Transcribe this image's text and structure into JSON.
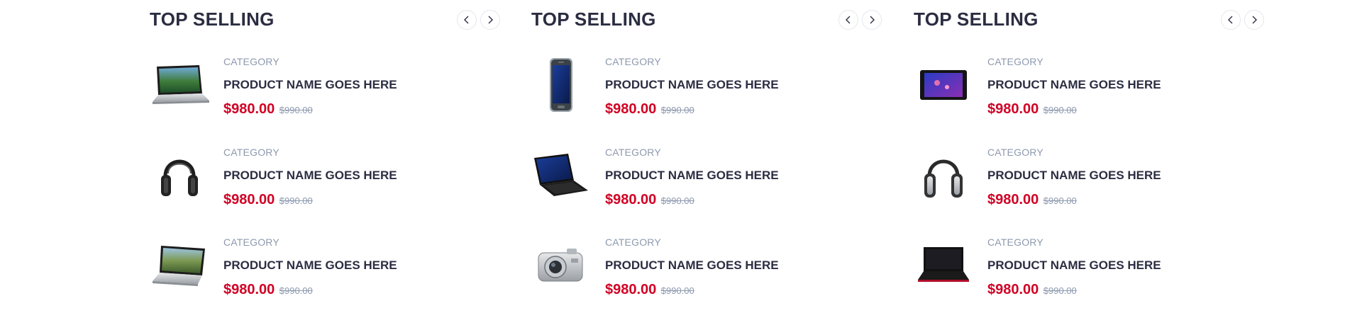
{
  "columns": [
    {
      "title": "TOP SELLING",
      "products": [
        {
          "icon": "laptop-silver-icon",
          "category": "CATEGORY",
          "name": "PRODUCT NAME GOES HERE",
          "price": "$980.00",
          "old_price": "$990.00"
        },
        {
          "icon": "headphones-black-icon",
          "category": "CATEGORY",
          "name": "PRODUCT NAME GOES HERE",
          "price": "$980.00",
          "old_price": "$990.00"
        },
        {
          "icon": "laptop-landscape-icon",
          "category": "CATEGORY",
          "name": "PRODUCT NAME GOES HERE",
          "price": "$980.00",
          "old_price": "$990.00"
        }
      ]
    },
    {
      "title": "TOP SELLING",
      "products": [
        {
          "icon": "smartphone-icon",
          "category": "CATEGORY",
          "name": "PRODUCT NAME GOES HERE",
          "price": "$980.00",
          "old_price": "$990.00"
        },
        {
          "icon": "laptop-dark-icon",
          "category": "CATEGORY",
          "name": "PRODUCT NAME GOES HERE",
          "price": "$980.00",
          "old_price": "$990.00"
        },
        {
          "icon": "camera-icon",
          "category": "CATEGORY",
          "name": "PRODUCT NAME GOES HERE",
          "price": "$980.00",
          "old_price": "$990.00"
        }
      ]
    },
    {
      "title": "TOP SELLING",
      "products": [
        {
          "icon": "tablet-icon",
          "category": "CATEGORY",
          "name": "PRODUCT NAME GOES HERE",
          "price": "$980.00",
          "old_price": "$990.00"
        },
        {
          "icon": "headphones-silver-icon",
          "category": "CATEGORY",
          "name": "PRODUCT NAME GOES HERE",
          "price": "$980.00",
          "old_price": "$990.00"
        },
        {
          "icon": "laptop-red-icon",
          "category": "CATEGORY",
          "name": "PRODUCT NAME GOES HERE",
          "price": "$980.00",
          "old_price": "$990.00"
        }
      ]
    }
  ],
  "nav": {
    "prev_icon": "chevron-left-icon",
    "next_icon": "chevron-right-icon"
  },
  "colors": {
    "accent": "#D10024",
    "text": "#2B2D42",
    "muted": "#8D99AE",
    "border": "#E4E7ED"
  }
}
